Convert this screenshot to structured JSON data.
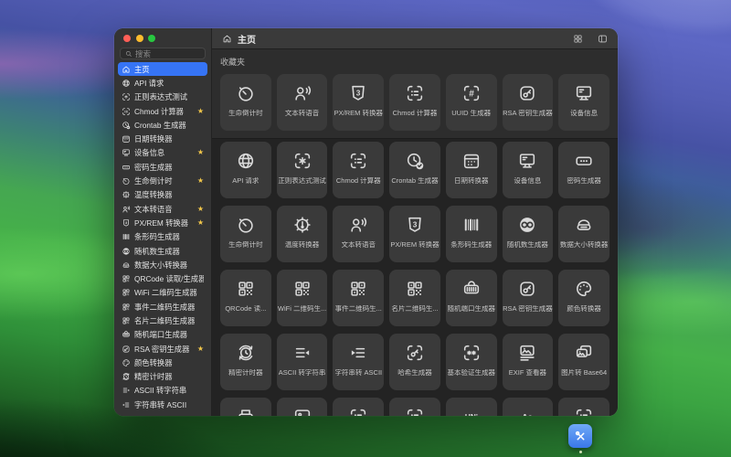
{
  "window": {
    "search_placeholder": "搜索",
    "header": {
      "title": "主页",
      "icon": "home",
      "right_icons": [
        "grid-view-icon",
        "toggle-sidebar-icon"
      ]
    },
    "traffic_lights": {
      "close": "#ff5f57",
      "minimize": "#febc2e",
      "zoom": "#28c840"
    },
    "sidebar": {
      "items": [
        {
          "label": "主页",
          "icon": "home",
          "selected": true,
          "starred": false
        },
        {
          "label": "API 请求",
          "icon": "globe",
          "selected": false,
          "starred": false
        },
        {
          "label": "正则表达式测试",
          "icon": "regex",
          "selected": false,
          "starred": false
        },
        {
          "label": "Chmod 计算器",
          "icon": "chmod",
          "selected": false,
          "starred": true
        },
        {
          "label": "Crontab 生成器",
          "icon": "crontab",
          "selected": false,
          "starred": false
        },
        {
          "label": "日期转换器",
          "icon": "calendar",
          "selected": false,
          "starred": false
        },
        {
          "label": "设备信息",
          "icon": "monitor",
          "selected": false,
          "starred": true
        },
        {
          "label": "密码生成器",
          "icon": "password",
          "selected": false,
          "starred": false
        },
        {
          "label": "生命倒计时",
          "icon": "stopwatch",
          "selected": false,
          "starred": true
        },
        {
          "label": "温度转换器",
          "icon": "thermo",
          "selected": false,
          "starred": false
        },
        {
          "label": "文本转语音",
          "icon": "tts",
          "selected": false,
          "starred": true
        },
        {
          "label": "PX/REM 转换器",
          "icon": "css",
          "selected": false,
          "starred": true
        },
        {
          "label": "条形码生成器",
          "icon": "barcode",
          "selected": false,
          "starred": false
        },
        {
          "label": "随机数生成器",
          "icon": "infinity",
          "selected": false,
          "starred": false
        },
        {
          "label": "数据大小转换器",
          "icon": "drive",
          "selected": false,
          "starred": false
        },
        {
          "label": "QRCode 读取/生成器",
          "icon": "qr",
          "selected": false,
          "starred": false
        },
        {
          "label": "WiFi 二维码生成器",
          "icon": "qr",
          "selected": false,
          "starred": false
        },
        {
          "label": "事件二维码生成器",
          "icon": "qr",
          "selected": false,
          "starred": false
        },
        {
          "label": "名片二维码生成器",
          "icon": "qr",
          "selected": false,
          "starred": false
        },
        {
          "label": "随机端口生成器",
          "icon": "port",
          "selected": false,
          "starred": false
        },
        {
          "label": "RSA 密钥生成器",
          "icon": "rsa",
          "selected": false,
          "starred": true
        },
        {
          "label": "颜色转换器",
          "icon": "palette",
          "selected": false,
          "starred": false
        },
        {
          "label": "精密计时器",
          "icon": "timer2",
          "selected": false,
          "starred": false
        },
        {
          "label": "ASCII 转字符串",
          "icon": "ascii2str",
          "selected": false,
          "starred": false
        },
        {
          "label": "字符串转 ASCII",
          "icon": "str2ascii",
          "selected": false,
          "starred": false
        }
      ]
    },
    "favorites": {
      "label": "收藏夹",
      "tiles": [
        {
          "label": "生命倒计时",
          "icon": "stopwatch"
        },
        {
          "label": "文本转语音",
          "icon": "tts"
        },
        {
          "label": "PX/REM 转换器",
          "icon": "css"
        },
        {
          "label": "Chmod 计算器",
          "icon": "chmod"
        },
        {
          "label": "UUID 生成器",
          "icon": "uuid"
        },
        {
          "label": "RSA 密钥生成器",
          "icon": "rsa"
        },
        {
          "label": "设备信息",
          "icon": "monitor"
        }
      ]
    },
    "grid": {
      "tiles": [
        {
          "label": "API 请求",
          "icon": "globe"
        },
        {
          "label": "正则表达式测试",
          "icon": "regex"
        },
        {
          "label": "Chmod 计算器",
          "icon": "chmod"
        },
        {
          "label": "Crontab 生成器",
          "icon": "crontab"
        },
        {
          "label": "日期转换器",
          "icon": "calendar"
        },
        {
          "label": "设备信息",
          "icon": "monitor"
        },
        {
          "label": "密码生成器",
          "icon": "password"
        },
        {
          "label": "生命倒计时",
          "icon": "stopwatch"
        },
        {
          "label": "温度转换器",
          "icon": "thermo"
        },
        {
          "label": "文本转语音",
          "icon": "tts"
        },
        {
          "label": "PX/REM 转换器",
          "icon": "css"
        },
        {
          "label": "条形码生成器",
          "icon": "barcode"
        },
        {
          "label": "随机数生成器",
          "icon": "infinity"
        },
        {
          "label": "数据大小转换器",
          "icon": "drive"
        },
        {
          "label": "QRCode 读...",
          "icon": "qr"
        },
        {
          "label": "WiFi 二维码生...",
          "icon": "qr"
        },
        {
          "label": "事件二维码生...",
          "icon": "qr"
        },
        {
          "label": "名片二维码生...",
          "icon": "qr"
        },
        {
          "label": "随机端口生成器",
          "icon": "port"
        },
        {
          "label": "RSA 密钥生成器",
          "icon": "rsa"
        },
        {
          "label": "颜色转换器",
          "icon": "palette"
        },
        {
          "label": "精密计时器",
          "icon": "timer2"
        },
        {
          "label": "ASCII 转字符串",
          "icon": "ascii2str"
        },
        {
          "label": "字符串转 ASCII",
          "icon": "str2ascii"
        },
        {
          "label": "哈希生成器",
          "icon": "hash"
        },
        {
          "label": "基本验证生成器",
          "icon": "basicauth"
        },
        {
          "label": "EXIF 查看器",
          "icon": "exif"
        },
        {
          "label": "图片转 Base64",
          "icon": "img64"
        },
        {
          "label": "",
          "icon": "printer"
        },
        {
          "label": "",
          "icon": "photo"
        },
        {
          "label": "",
          "icon": "chmod"
        },
        {
          "label": "",
          "icon": "chmod"
        },
        {
          "label": "",
          "icon": "textuni"
        },
        {
          "label": "",
          "icon": "textaa"
        },
        {
          "label": "",
          "icon": "chmod"
        }
      ]
    }
  },
  "desktop": {
    "dock_icon": "toolbox-icon",
    "dock_icon_color": "#3b82f7"
  }
}
